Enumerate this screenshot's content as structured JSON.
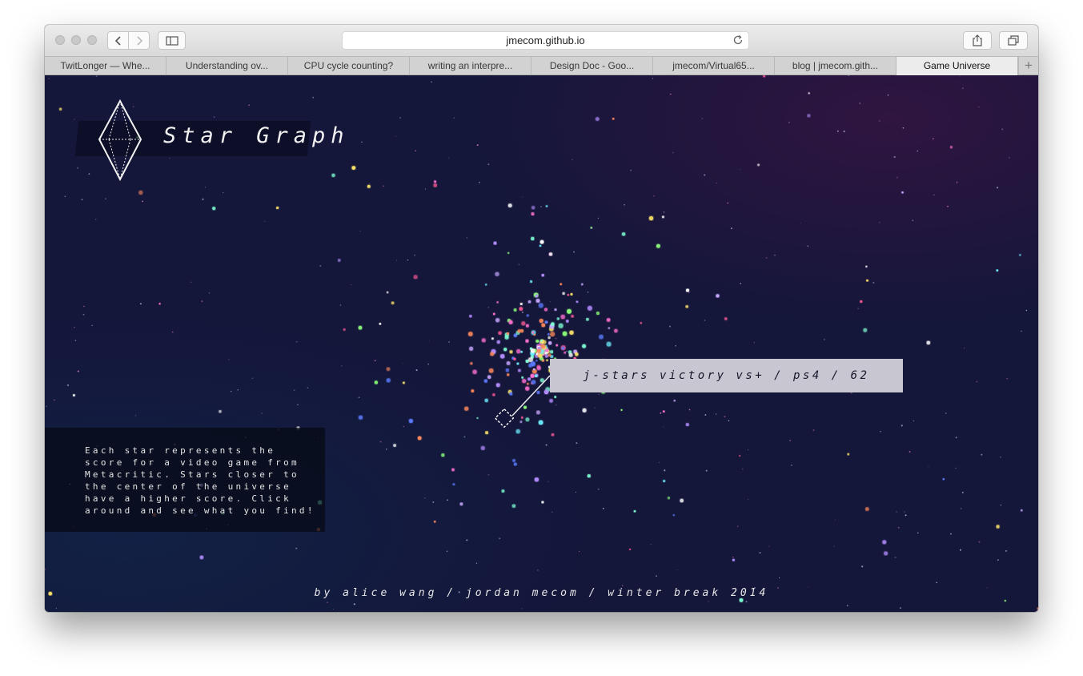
{
  "browser": {
    "url": "jmecom.github.io",
    "tabs": [
      {
        "label": "TwitLonger — Whe...",
        "active": false
      },
      {
        "label": "Understanding ov...",
        "active": false
      },
      {
        "label": "CPU cycle counting?",
        "active": false
      },
      {
        "label": "writing an interpre...",
        "active": false
      },
      {
        "label": "Design Doc - Goo...",
        "active": false
      },
      {
        "label": "jmecom/Virtual65...",
        "active": false
      },
      {
        "label": "blog | jmecom.gith...",
        "active": false
      },
      {
        "label": "Game Universe",
        "active": true
      }
    ],
    "new_tab_label": "+"
  },
  "page": {
    "title": "Star Graph",
    "info": "Each star represents the\nscore for a video game from\nMetacritic. Stars closer to\nthe center of the universe\nhave a higher score. Click\naround and see what you find!",
    "selected_game": "j-stars victory vs+ / ps4 / 62",
    "credits": "by alice wang / jordan mecom / winter break 2014"
  },
  "colors": {
    "background": "#14163a",
    "tooltip_bg": "#c8c6d0",
    "tooltip_text": "#15152a",
    "text": "#f2f2f2"
  },
  "icons": {
    "back": "chevron-left-icon",
    "forward": "chevron-right-icon",
    "sidebar": "sidebar-icon",
    "reload": "reload-icon",
    "share": "share-icon",
    "tabs_overview": "tabs-overview-icon",
    "logo": "diamond-logo-icon",
    "selection_marker": "diamond-marker-icon"
  }
}
